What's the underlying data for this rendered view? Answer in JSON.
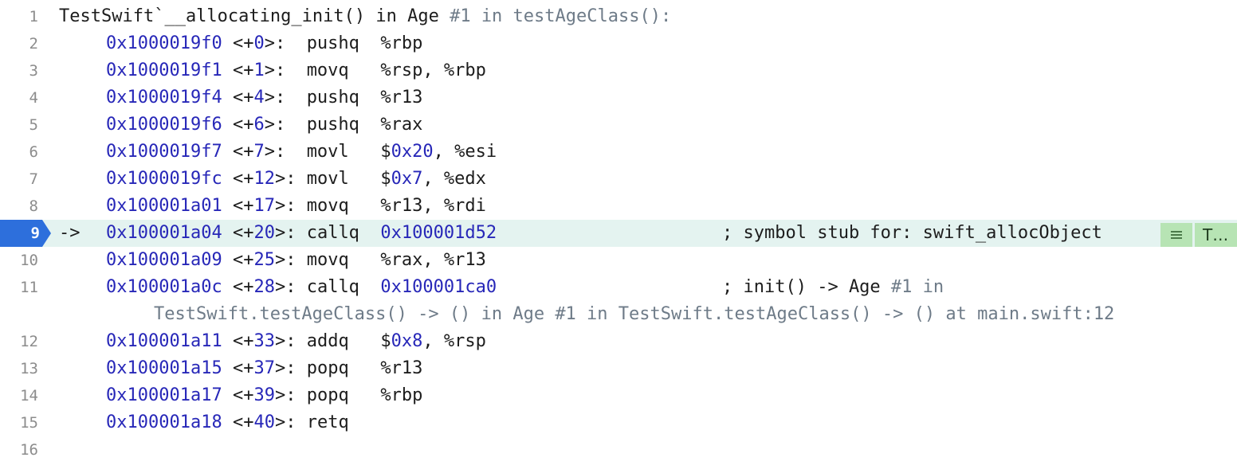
{
  "header": {
    "line_number": "1",
    "prefix": "TestSwift`__allocating_init() in Age ",
    "suffix": "#1 in testAgeClass():"
  },
  "instructions": [
    {
      "line": "2",
      "addr": "0x1000019f0",
      "off_pre": "<+",
      "off_num": "0",
      "off_post": ">:  ",
      "op": "pushq  ",
      "a1": "%rbp",
      "a2": "",
      "a3": ""
    },
    {
      "line": "3",
      "addr": "0x1000019f1",
      "off_pre": "<+",
      "off_num": "1",
      "off_post": ">:  ",
      "op": "movq   ",
      "a1": "%rsp, %rbp",
      "a2": "",
      "a3": ""
    },
    {
      "line": "4",
      "addr": "0x1000019f4",
      "off_pre": "<+",
      "off_num": "4",
      "off_post": ">:  ",
      "op": "pushq  ",
      "a1": "%r13",
      "a2": "",
      "a3": ""
    },
    {
      "line": "5",
      "addr": "0x1000019f6",
      "off_pre": "<+",
      "off_num": "6",
      "off_post": ">:  ",
      "op": "pushq  ",
      "a1": "%rax",
      "a2": "",
      "a3": ""
    },
    {
      "line": "6",
      "addr": "0x1000019f7",
      "off_pre": "<+",
      "off_num": "7",
      "off_post": ">:  ",
      "op": "movl   ",
      "a1": "$",
      "a2": "0x20",
      "a3": ", %esi"
    },
    {
      "line": "7",
      "addr": "0x1000019fc",
      "off_pre": "<+",
      "off_num": "12",
      "off_post": ">: ",
      "op": "movl   ",
      "a1": "$",
      "a2": "0x7",
      "a3": ", %edx"
    },
    {
      "line": "8",
      "addr": "0x100001a01",
      "off_pre": "<+",
      "off_num": "17",
      "off_post": ">: ",
      "op": "movq   ",
      "a1": "%r13, %rdi",
      "a2": "",
      "a3": ""
    }
  ],
  "current": {
    "line": "9",
    "arrow": "->",
    "addr": "0x100001a04",
    "off_pre": "<+",
    "off_num": "20",
    "off_post": ">: ",
    "op": "callq  ",
    "target": "0x100001d52",
    "comment": "; symbol stub for: swift_allocObject",
    "badge_text": "T…"
  },
  "line10": {
    "line": "10",
    "addr": "0x100001a09",
    "off_pre": "<+",
    "off_num": "25",
    "off_post": ">: ",
    "op": "movq   ",
    "a1": "%rax, %r13"
  },
  "line11": {
    "line": "11",
    "addr": "0x100001a0c",
    "off_pre": "<+",
    "off_num": "28",
    "off_post": ">: ",
    "op": "callq  ",
    "target": "0x100001ca0",
    "comment_a": "; init() -> Age ",
    "comment_b": "#1 in",
    "wrap": "TestSwift.testAgeClass() -> () in Age #1 in TestSwift.testAgeClass() -> () at main.swift:12"
  },
  "tail": [
    {
      "line": "12",
      "addr": "0x100001a11",
      "off_pre": "<+",
      "off_num": "33",
      "off_post": ">: ",
      "op": "addq   ",
      "a1": "$",
      "a2": "0x8",
      "a3": ", %rsp"
    },
    {
      "line": "13",
      "addr": "0x100001a15",
      "off_pre": "<+",
      "off_num": "37",
      "off_post": ">: ",
      "op": "popq   ",
      "a1": "%r13",
      "a2": "",
      "a3": ""
    },
    {
      "line": "14",
      "addr": "0x100001a17",
      "off_pre": "<+",
      "off_num": "39",
      "off_post": ">: ",
      "op": "popq   ",
      "a1": "%rbp",
      "a2": "",
      "a3": ""
    },
    {
      "line": "15",
      "addr": "0x100001a18",
      "off_pre": "<+",
      "off_num": "40",
      "off_post": ">: ",
      "op": "retq",
      "a1": "",
      "a2": "",
      "a3": ""
    }
  ],
  "last_line": "16",
  "colors": {
    "address": "#2727b8",
    "current_line_bg": "#e4f3f0",
    "pc_marker": "#2d6fdc",
    "badge_bg": "#b7e4b4"
  }
}
